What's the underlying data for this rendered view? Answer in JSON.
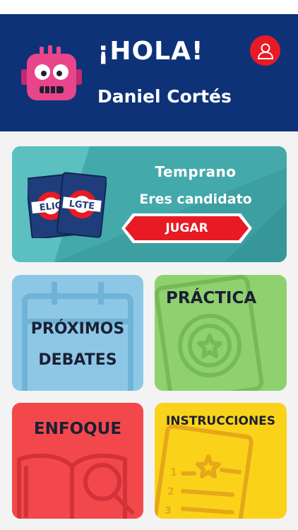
{
  "header": {
    "greeting": "¡HOLA!",
    "user_name": "Daniel Cortés"
  },
  "icons": {
    "avatar": "robot-avatar-icon",
    "profile": "user-icon"
  },
  "banner": {
    "title": "Temprano",
    "status": "Eres candidato",
    "play_label": "JUGAR",
    "logo_text": "ELIGTE"
  },
  "tiles": [
    {
      "label_line1": "PRÓXIMOS",
      "label_line2": "DEBATES"
    },
    {
      "label": "PRÁCTICA"
    },
    {
      "label": "ENFOQUE"
    },
    {
      "label": "INSTRUCCIONES"
    }
  ],
  "colors": {
    "header_bg": "#0d3278",
    "accent_red": "#e81a24",
    "banner_bg": "#3e9fa1",
    "tile_blue": "#8cc8e6",
    "tile_green": "#8fd16f",
    "tile_red": "#f2484c",
    "tile_yellow": "#fbd21a"
  }
}
